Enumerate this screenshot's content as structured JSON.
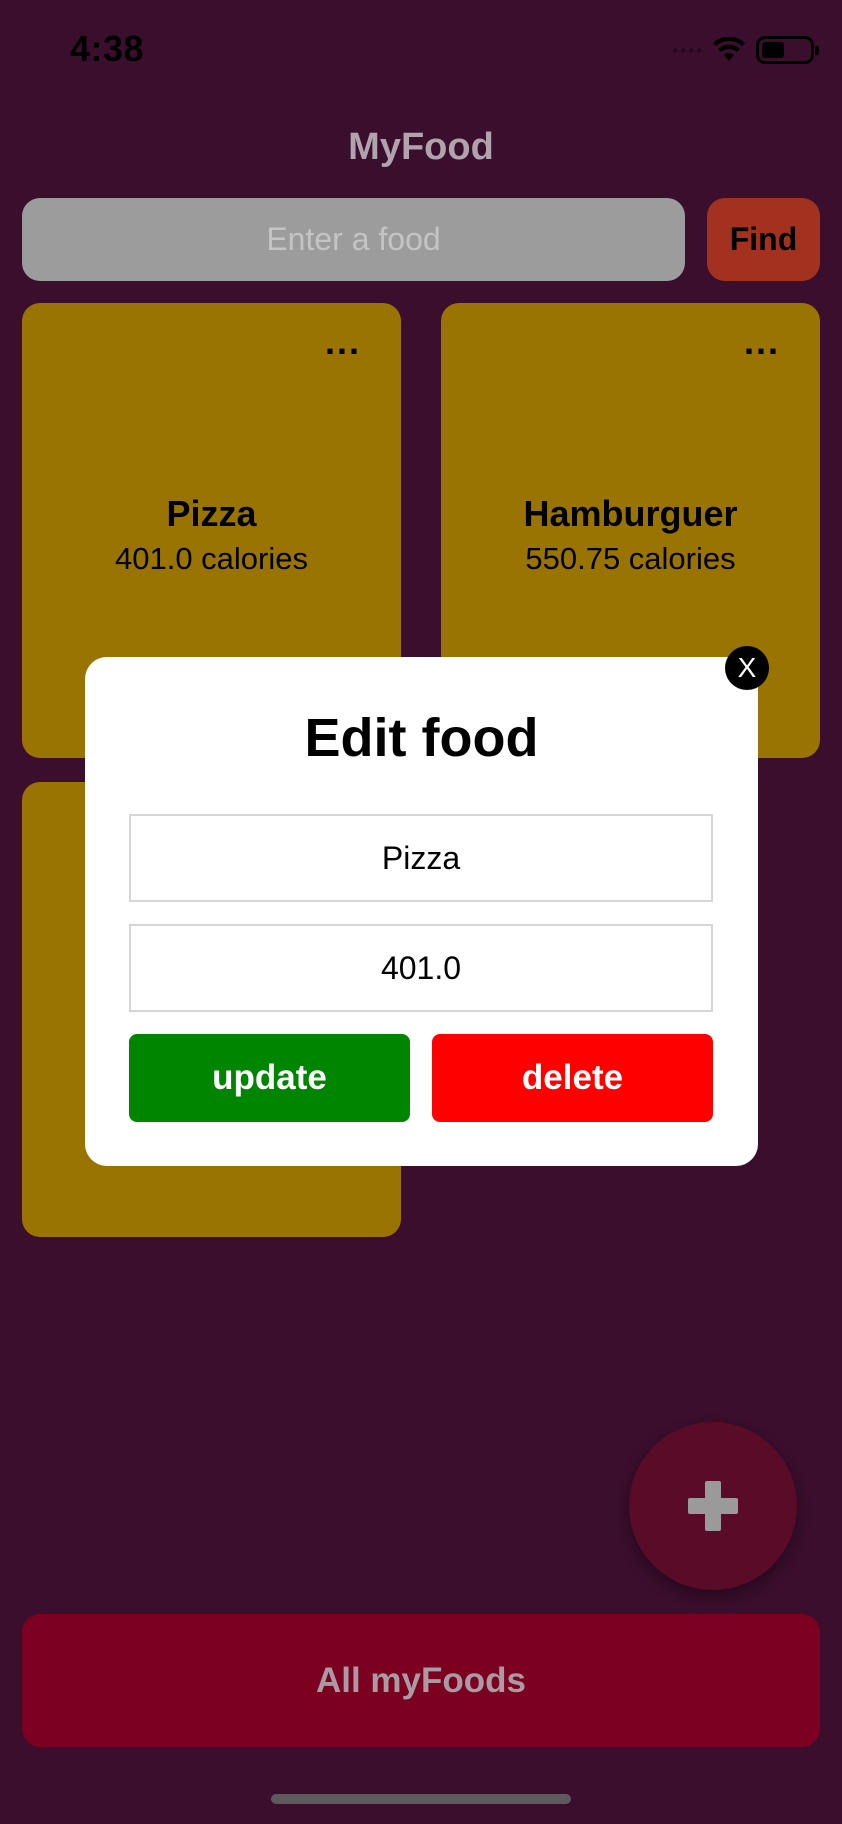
{
  "status_bar": {
    "time": "4:38",
    "icons": [
      "signal-icon",
      "wifi-icon",
      "battery-icon"
    ]
  },
  "app": {
    "title": "MyFood"
  },
  "search": {
    "placeholder": "Enter a food",
    "value": "",
    "find_label": "Find"
  },
  "foods": [
    {
      "name": "Pizza",
      "calories": "401.0 calories",
      "menu_label": "..."
    },
    {
      "name": "Hamburguer",
      "calories": "550.75 calories",
      "menu_label": "..."
    }
  ],
  "edit_modal": {
    "title": "Edit food",
    "close_label": "X",
    "name_value": "Pizza",
    "calories_value": "401.0",
    "update_label": "update",
    "delete_label": "delete"
  },
  "fab": {
    "icon": "plus-icon"
  },
  "footer": {
    "all_label": "All myFoods"
  },
  "colors": {
    "background": "#3a0e2c",
    "card": "#9a7402",
    "find_button": "#a3311f",
    "update_button": "#008500",
    "delete_button": "#ff0000",
    "fab": "#5a0b28",
    "footer_button": "#7c0020"
  }
}
